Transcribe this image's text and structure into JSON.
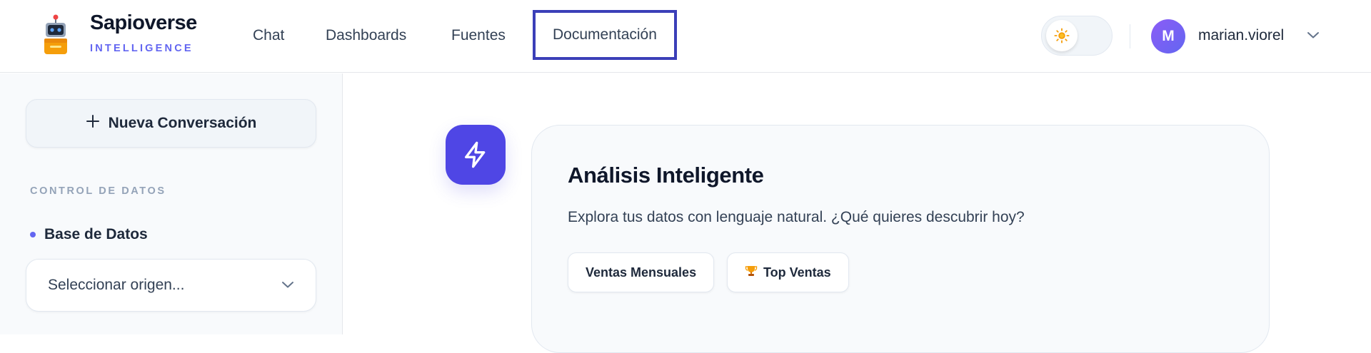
{
  "brand": {
    "name": "Sapioverse",
    "subtitle": "INTELLIGENCE",
    "logo_icon": "robot-icon"
  },
  "nav": {
    "items": [
      {
        "label": "Chat"
      },
      {
        "label": "Dashboards"
      },
      {
        "label": "Fuentes"
      },
      {
        "label": "Documentación",
        "active": true
      }
    ]
  },
  "header": {
    "theme_toggle_icon": "sun-icon",
    "user": {
      "initial": "M",
      "name": "marian.viorel",
      "menu_icon": "chevron-down-icon"
    }
  },
  "sidebar": {
    "new_chat_label": "Nueva Conversación",
    "new_chat_icon": "plus-icon",
    "section_title": "CONTROL DE DATOS",
    "db_label": "Base de Datos",
    "source_select": {
      "value": "Seleccionar origen..."
    }
  },
  "main": {
    "badge_icon": "bolt-icon",
    "card": {
      "title": "Análisis Inteligente",
      "description": "Explora tus datos con lenguaje natural. ¿Qué quieres descubrir hoy?",
      "chips": [
        {
          "label": "Ventas Mensuales"
        },
        {
          "label": "Top Ventas",
          "icon": "trophy-icon"
        }
      ]
    }
  },
  "colors": {
    "accent": "#4f46e5",
    "brand_sub": "#6366f1",
    "active_nav_border": "#3b3fb8"
  }
}
